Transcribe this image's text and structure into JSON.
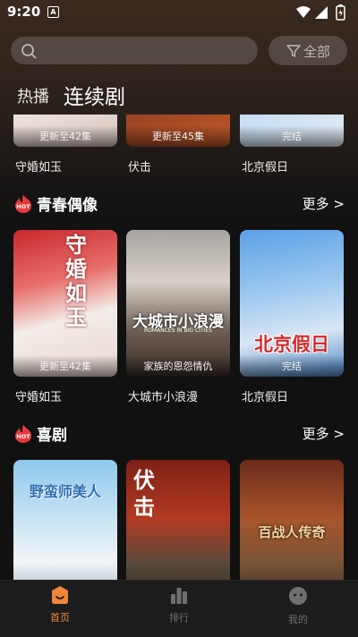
{
  "status_bar": {
    "time": "9:20",
    "notification": "A"
  },
  "search": {
    "placeholder": "",
    "filter_label": "全部"
  },
  "tabs": [
    {
      "label": "热播"
    },
    {
      "label": "连续剧"
    }
  ],
  "top_row": [
    {
      "title": "守婚如玉",
      "badge": "更新至42集"
    },
    {
      "title": "伏击",
      "badge": "更新至45集"
    },
    {
      "title": "北京假日",
      "badge": "完结"
    }
  ],
  "sections": [
    {
      "name": "青春偶像",
      "more": "更多 >",
      "hot_label": "HOT",
      "items": [
        {
          "title": "守婚如玉",
          "badge": "更新至42集",
          "poster_text": "守婚如玉"
        },
        {
          "title": "大城市小浪漫",
          "badge": "家族的恩怨情仇",
          "poster_text": "大城市小浪漫",
          "poster_sub": "ROMANCES IN BIG CITIES"
        },
        {
          "title": "北京假日",
          "badge": "完结",
          "poster_text": "北京假日"
        }
      ]
    },
    {
      "name": "喜剧",
      "more": "更多 >",
      "hot_label": "HOT",
      "items": [
        {
          "title": "",
          "poster_text": "野蛮师美人"
        },
        {
          "title": "",
          "poster_text": "伏击"
        },
        {
          "title": "",
          "poster_text": "百战人传奇"
        }
      ]
    }
  ],
  "bottom_nav": [
    {
      "label": "首页",
      "icon": "home-icon",
      "active": true
    },
    {
      "label": "排行",
      "icon": "ranking-icon",
      "active": false
    },
    {
      "label": "我的",
      "icon": "profile-icon",
      "active": false
    }
  ],
  "colors": {
    "accent": "#f0853a",
    "hot_red": "#e8393d",
    "inactive": "#6f6f6f"
  }
}
